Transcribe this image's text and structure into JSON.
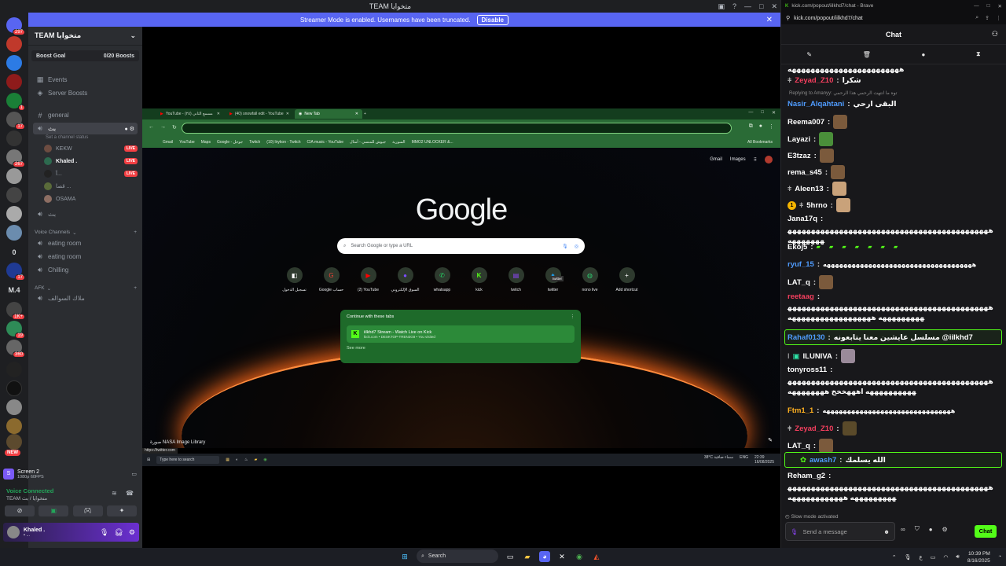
{
  "discord": {
    "window_title": "TEAM متخوايا",
    "streamer_bar": {
      "text": "Streamer Mode is enabled. Usernames have been truncated.",
      "disable_label": "Disable"
    },
    "server_rail": {
      "badges": [
        "297",
        "1",
        "17",
        "267",
        "1",
        "17",
        "1K+",
        "19",
        "360"
      ],
      "text_items": [
        "0",
        "M.4"
      ],
      "new_label": "NEW"
    },
    "server_name": "TEAM متخوايا",
    "boost_goal": {
      "label": "Boost Goal",
      "progress": "0/20 Boosts"
    },
    "nav": {
      "events": "Events",
      "server_boosts": "Server Boosts"
    },
    "channels": {
      "general": "general",
      "active_voice": "بث",
      "active_voice_status": "Set a channel status",
      "voice_users": [
        {
          "name": "KEKW",
          "live": "LIVE"
        },
        {
          "name": "Khaled .",
          "live": "LIVE"
        },
        {
          "name": "آ...",
          "live": "LIVE"
        },
        {
          "name": "ﻗﺼﺎ ...",
          "live": ""
        },
        {
          "name": "OSAMA",
          "live": ""
        }
      ],
      "second_voice": "بث",
      "voice_category": "Voice Channels",
      "eating_room_1": "eating room",
      "eating_room_2": "eating room",
      "chilling": "Chilling",
      "afk_category": "AFK",
      "afk_channel": "ملاك السوالف"
    },
    "screen_share": {
      "title": "Screen 2",
      "sub": "1080p 60FPS"
    },
    "voice": {
      "connected": "Voice Connected",
      "location": "TEAM متخوايا / بث"
    },
    "user": {
      "name": "Khaled .",
      "status": "• ..."
    }
  },
  "chrome": {
    "tabs": [
      "YouTube - (٢٥) مسمع الثاني",
      "(40) snowfall edit - YouTube",
      "New Tab"
    ],
    "bookmarks": [
      "Gmail",
      "YouTube",
      "Maps",
      "Google - جوجل",
      "Twitch",
      "(10) lirykon - Twitch",
      "CIA music - YouTube",
      "جيوش للمنسي - أمثال",
      "السورية",
      "MMO2 UNLOCKER &...",
      "All Bookmarks"
    ],
    "ntp_links": [
      "Gmail",
      "Images"
    ],
    "logo": "Google",
    "search_placeholder": "Search Google or type a URL",
    "shortcuts": [
      "تسجيل الدخول",
      "Google حساب",
      "(2) YouTube",
      "السوق الإلكتروني",
      "whatsapp",
      "kick",
      "twitch",
      "twitter",
      "nono live",
      "Add shortcut"
    ],
    "tooltip": "twitter",
    "continue_title": "Continue with these tabs",
    "continue_item": "iilkhd7 Stream - Watch Live on Kick",
    "continue_sub": "kick.com • DESKTOP-TREN3G8 • You visited",
    "continue_more": "See more",
    "credit": "صورة NASA Image Library",
    "status_url": "https://twitter.com",
    "inner_taskbar": {
      "search": "Type here to search",
      "weather": "38°C سماء صافية",
      "lang": "ENG",
      "time": "22:39",
      "date": "16/08/2025"
    }
  },
  "kick": {
    "browser_title": "kick.com/popout/iilkhd7/chat - Brave",
    "url": "kick.com/popout/iilkhd7/chat",
    "header": "Chat",
    "messages": [
      {
        "user": "Zeyad_Z10",
        "color": "#f43f5e",
        "text": "شكرا"
      },
      {
        "user": "Nasir_Alqahtani",
        "color": "#4f9cff",
        "text": "البقى ارحي"
      },
      {
        "user": "Reema007",
        "color": "#ffffff",
        "text": ""
      },
      {
        "user": "Layazi",
        "color": "#ffffff",
        "text": ""
      },
      {
        "user": "E3tzaz",
        "color": "#ffffff",
        "text": ""
      },
      {
        "user": "rema_s45",
        "color": "#ffffff",
        "text": ""
      },
      {
        "user": "Aleen13",
        "color": "#ffffff",
        "text": ""
      },
      {
        "user": "5hrno",
        "color": "#ffffff",
        "text": ""
      },
      {
        "user": "Jana17q",
        "color": "#ffffff",
        "text": ""
      },
      {
        "user": "Ekoj5",
        "color": "#ffffff",
        "text": ""
      },
      {
        "user": "ryuf_15",
        "color": "#4f9cff",
        "text": "ههههههههههههههههههههههههههههههههههههه"
      },
      {
        "user": "LAT_q",
        "color": "#ffffff",
        "text": ""
      },
      {
        "user": "reetaag",
        "color": "#f43f5e",
        "text": ""
      },
      {
        "user": "Rahaf0130",
        "color": "#4f9cff",
        "text": "مسلسل عايشين معنا يتابعونه @iilkhd7"
      },
      {
        "user": "ILUNIVA",
        "color": "#ffffff",
        "text": ""
      },
      {
        "user": "tonyross11",
        "color": "#ffffff",
        "text": ""
      },
      {
        "user": "Ftm1_1",
        "color": "#ffb020",
        "text": "هههههههههههههههههههههههههههههههه"
      },
      {
        "user": "Zeyad_Z10",
        "color": "#f43f5e",
        "text": ""
      },
      {
        "user": "LAT_q",
        "color": "#ffffff",
        "text": ""
      },
      {
        "user": "awash7",
        "color": "#4f9cff",
        "text": "الله يسلمك"
      },
      {
        "user": "Reham_g2",
        "color": "#ffffff",
        "text": ""
      }
    ],
    "reply_hint": "Replying to Amanyy:",
    "reply_quote": "توه ما انتهت الرحمي هذا الرحمي",
    "wrapped_texts": {
      "top": "ههههههههههههههههههههههههه",
      "jana": "هههههههههههههههههههههههههههههههههههههههههههههههههههه",
      "reetaag": "هههههههههههههههههههههههههههههههههههههههههههههههههههههه ههههههههههههههههههه",
      "tony": "ههههههههههههههههههههههههههههههههههههههههههههههههههههههه اهههخخخ ههههههههه",
      "reham": "هههههههههههههههههههههههههههههههههههههههههههههههههههههه ههههههههههههه"
    },
    "slow_mode": "Slow mode activated",
    "input_placeholder": "Send a message",
    "send_label": "Chat"
  },
  "taskbar": {
    "search": "Search",
    "time": "10:39 PM",
    "date": "8/16/2025"
  }
}
